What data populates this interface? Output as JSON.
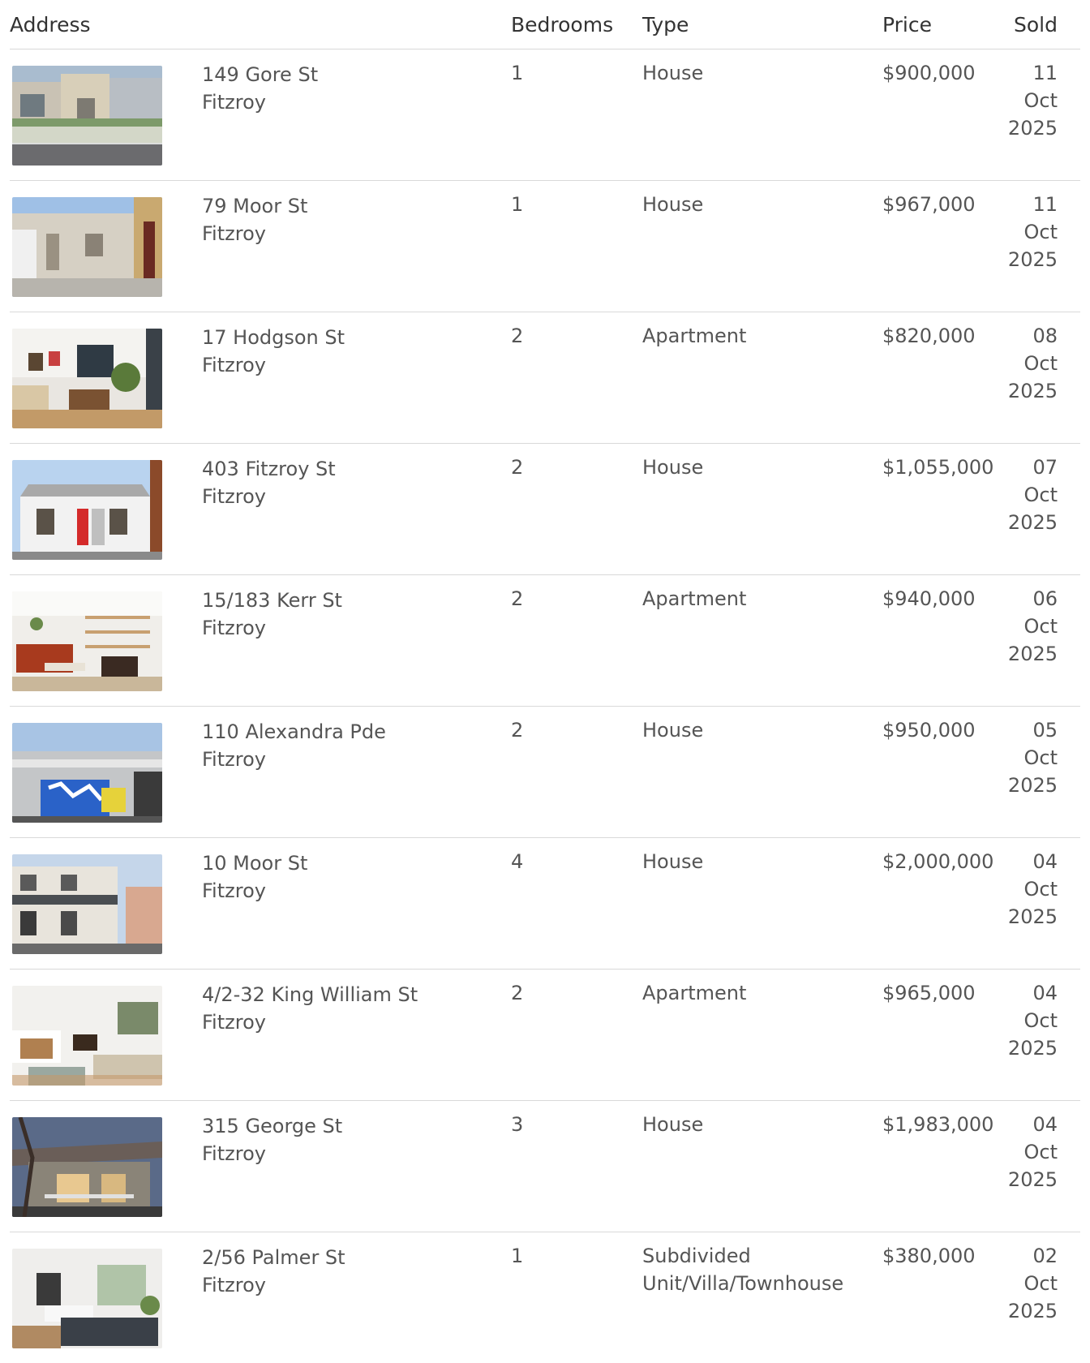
{
  "header": {
    "address": "Address",
    "bedrooms": "Bedrooms",
    "type": "Type",
    "price": "Price",
    "sold": "Sold"
  },
  "rows": [
    {
      "street": "149 Gore St",
      "suburb": "Fitzroy",
      "beds": "1",
      "type": "House",
      "price": "$900,000",
      "day": "11",
      "month": "Oct",
      "year": "2025"
    },
    {
      "street": "79 Moor St",
      "suburb": "Fitzroy",
      "beds": "1",
      "type": "House",
      "price": "$967,000",
      "day": "11",
      "month": "Oct",
      "year": "2025"
    },
    {
      "street": "17 Hodgson St",
      "suburb": "Fitzroy",
      "beds": "2",
      "type": "Apartment",
      "price": "$820,000",
      "day": "08",
      "month": "Oct",
      "year": "2025"
    },
    {
      "street": "403 Fitzroy St",
      "suburb": "Fitzroy",
      "beds": "2",
      "type": "House",
      "price": "$1,055,000",
      "day": "07",
      "month": "Oct",
      "year": "2025"
    },
    {
      "street": "15/183 Kerr St",
      "suburb": "Fitzroy",
      "beds": "2",
      "type": "Apartment",
      "price": "$940,000",
      "day": "06",
      "month": "Oct",
      "year": "2025"
    },
    {
      "street": "110 Alexandra Pde",
      "suburb": "Fitzroy",
      "beds": "2",
      "type": "House",
      "price": "$950,000",
      "day": "05",
      "month": "Oct",
      "year": "2025"
    },
    {
      "street": "10 Moor St",
      "suburb": "Fitzroy",
      "beds": "4",
      "type": "House",
      "price": "$2,000,000",
      "day": "04",
      "month": "Oct",
      "year": "2025"
    },
    {
      "street": "4/2-32 King William St",
      "suburb": "Fitzroy",
      "beds": "2",
      "type": "Apartment",
      "price": "$965,000",
      "day": "04",
      "month": "Oct",
      "year": "2025"
    },
    {
      "street": "315 George St",
      "suburb": "Fitzroy",
      "beds": "3",
      "type": "House",
      "price": "$1,983,000",
      "day": "04",
      "month": "Oct",
      "year": "2025"
    },
    {
      "street": "2/56 Palmer St",
      "suburb": "Fitzroy",
      "beds": "1",
      "type": "Subdivided Unit/Villa/Townhouse",
      "price": "$380,000",
      "day": "02",
      "month": "Oct",
      "year": "2025"
    }
  ]
}
